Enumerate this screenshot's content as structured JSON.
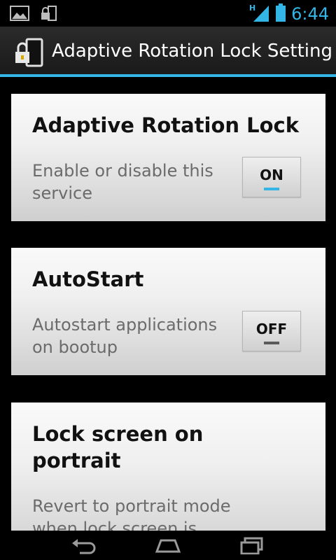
{
  "status_bar": {
    "time": "6:44",
    "network": "H",
    "icons": [
      "gallery-notification-icon",
      "lock-notification-icon",
      "signal-icon",
      "battery-icon"
    ]
  },
  "action_bar": {
    "title": "Adaptive Rotation Lock Setting",
    "icon": "rotation-lock-app-icon"
  },
  "settings": [
    {
      "title": "Adaptive Rotation Lock",
      "summary": "Enable or disable this service",
      "toggle": "ON",
      "state": true
    },
    {
      "title": "AutoStart",
      "summary": "Autostart applications on bootup",
      "toggle": "OFF",
      "state": false
    },
    {
      "title": "Lock screen on portrait",
      "summary": "Revert to portrait mode when lock screen is"
    }
  ],
  "nav_bar": {
    "icons": [
      "back-icon",
      "home-icon",
      "recent-apps-icon"
    ]
  },
  "colors": {
    "accent": "#33b5e5",
    "background": "#000000",
    "card_text": "#111111",
    "summary_text": "#6b6b6b"
  }
}
